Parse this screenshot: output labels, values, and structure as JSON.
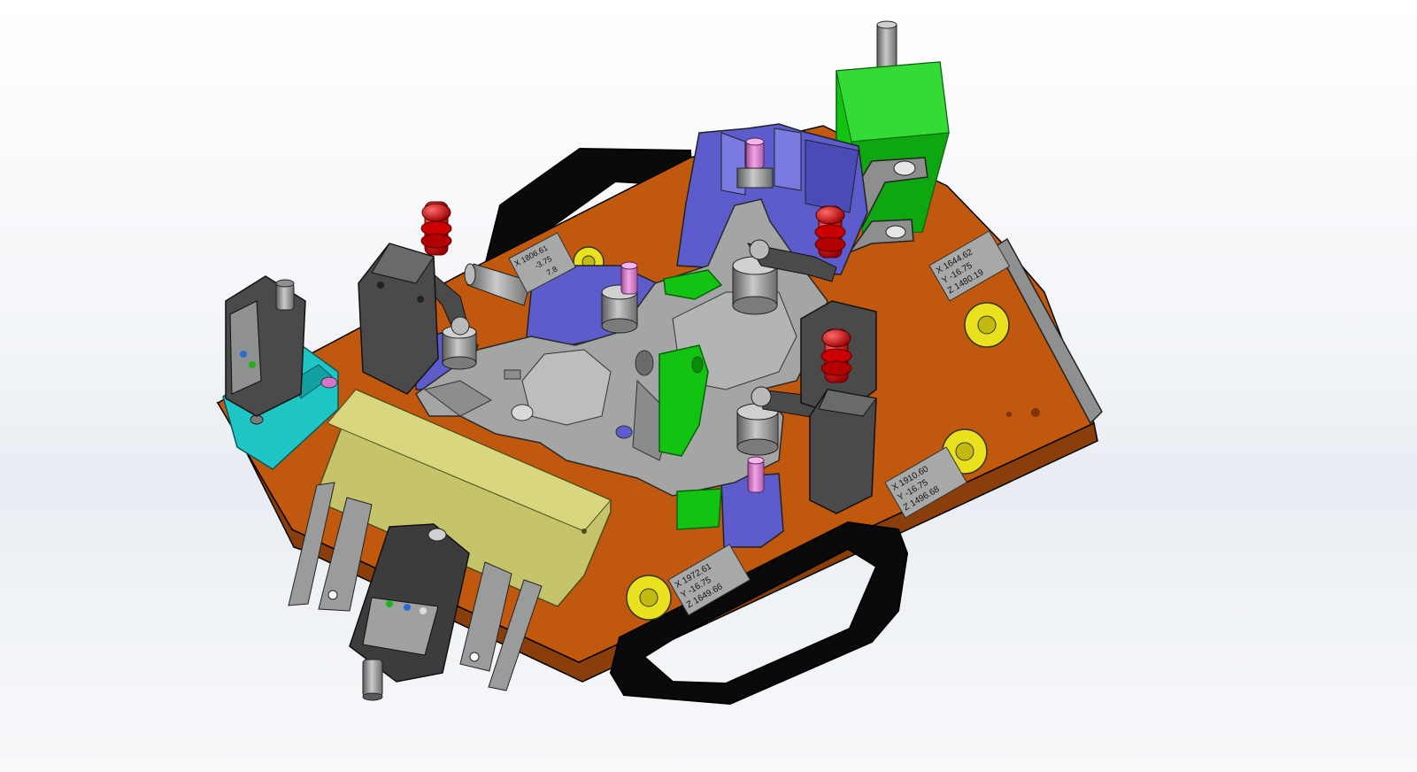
{
  "scene": {
    "colors": {
      "plate": "#c0580e",
      "plate_side": "#8a3f0b",
      "handle": "#0a0a0a",
      "violet": "#5c5ccc",
      "green": "#12c312",
      "cyan": "#1fc6c6",
      "khaki": "#c6c46a",
      "red_knob": "#d11111",
      "pin": "#d874c8",
      "yellow_bush": "#e9e11e",
      "gray_part": "#a4a6a6",
      "dark_gray": "#4a4a4a"
    },
    "labels": [
      {
        "x": "X 1806.61",
        "y": "-3.75",
        "z": "7.8"
      },
      {
        "x": "X 1644.62",
        "y": "Y -16.75",
        "z": "Z 1480.19"
      },
      {
        "x": "X 1910.60",
        "y": "Y -16.75",
        "z": "Z 1496.68"
      },
      {
        "x": "X 1972.61",
        "y": "Y -16.75",
        "z": "Z 1649.66"
      }
    ]
  }
}
